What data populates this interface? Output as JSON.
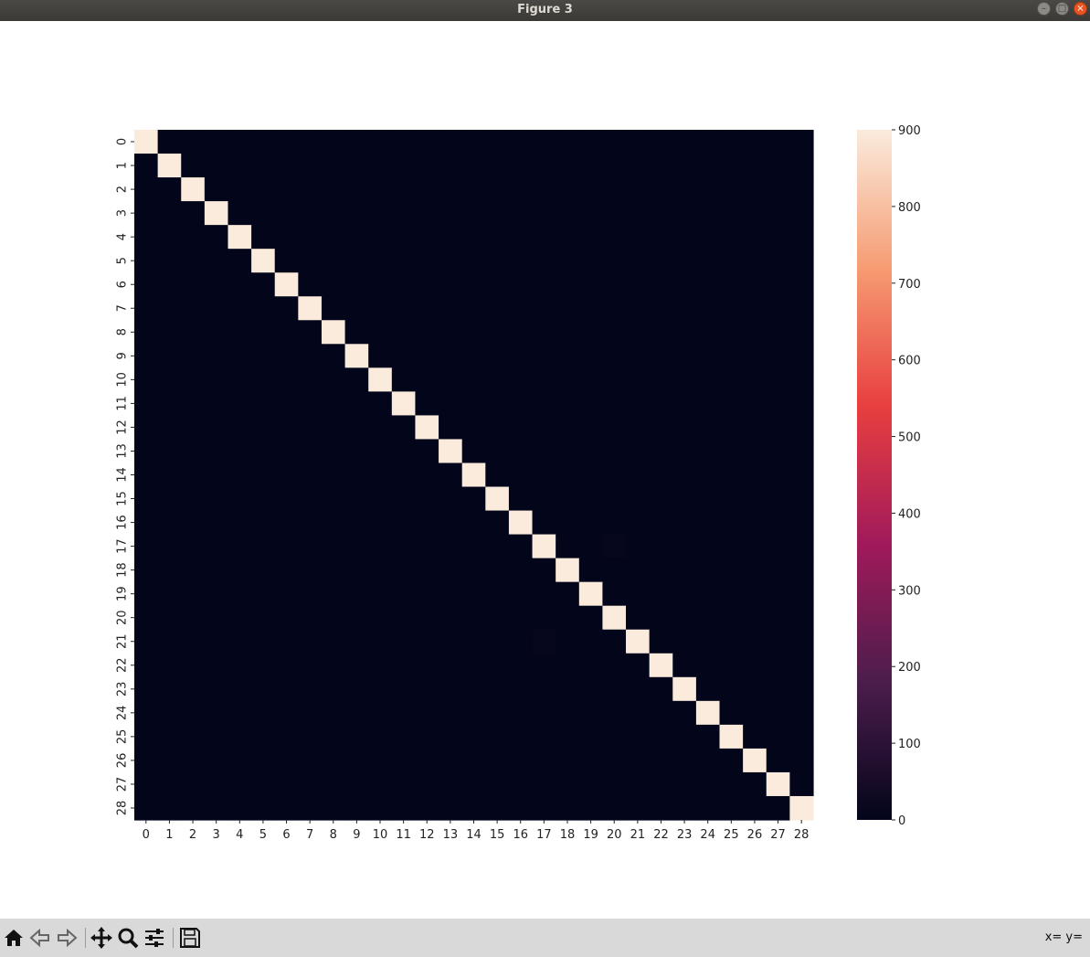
{
  "window": {
    "title": "Figure 3"
  },
  "toolbar": {
    "buttons": [
      "home-icon",
      "back-icon",
      "forward-icon",
      "pan-icon",
      "zoom-icon",
      "configure-icon",
      "save-icon"
    ],
    "coords_text": "x= y="
  },
  "chart_data": {
    "type": "heatmap",
    "title": "",
    "xlabel": "",
    "ylabel": "",
    "x_categories": [
      "0",
      "1",
      "2",
      "3",
      "4",
      "5",
      "6",
      "7",
      "8",
      "9",
      "10",
      "11",
      "12",
      "13",
      "14",
      "15",
      "16",
      "17",
      "18",
      "19",
      "20",
      "21",
      "22",
      "23",
      "24",
      "25",
      "26",
      "27",
      "28"
    ],
    "y_categories": [
      "0",
      "1",
      "2",
      "3",
      "4",
      "5",
      "6",
      "7",
      "8",
      "9",
      "10",
      "11",
      "12",
      "13",
      "14",
      "15",
      "16",
      "17",
      "18",
      "19",
      "20",
      "21",
      "22",
      "23",
      "24",
      "25",
      "26",
      "27",
      "28"
    ],
    "diagonal_values": [
      900,
      900,
      900,
      900,
      900,
      900,
      900,
      900,
      900,
      900,
      900,
      900,
      900,
      900,
      900,
      900,
      900,
      900,
      900,
      900,
      900,
      900,
      900,
      900,
      900,
      900,
      900,
      900,
      900
    ],
    "off_diagonal_nonzero": [
      {
        "row": 17,
        "col": 20,
        "value": 8
      },
      {
        "row": 21,
        "col": 17,
        "value": 8
      }
    ],
    "off_diagonal_default": 0,
    "colorbar": {
      "min": 0,
      "max": 900,
      "ticks": [
        "0",
        "100",
        "200",
        "300",
        "400",
        "500",
        "600",
        "700",
        "800",
        "900"
      ]
    },
    "colormap": [
      "#03051a",
      "#4c1d4b",
      "#a11a5b",
      "#e83f3f",
      "#f69c73",
      "#faebdd"
    ],
    "grid": false,
    "legend": "colorbar-right"
  }
}
